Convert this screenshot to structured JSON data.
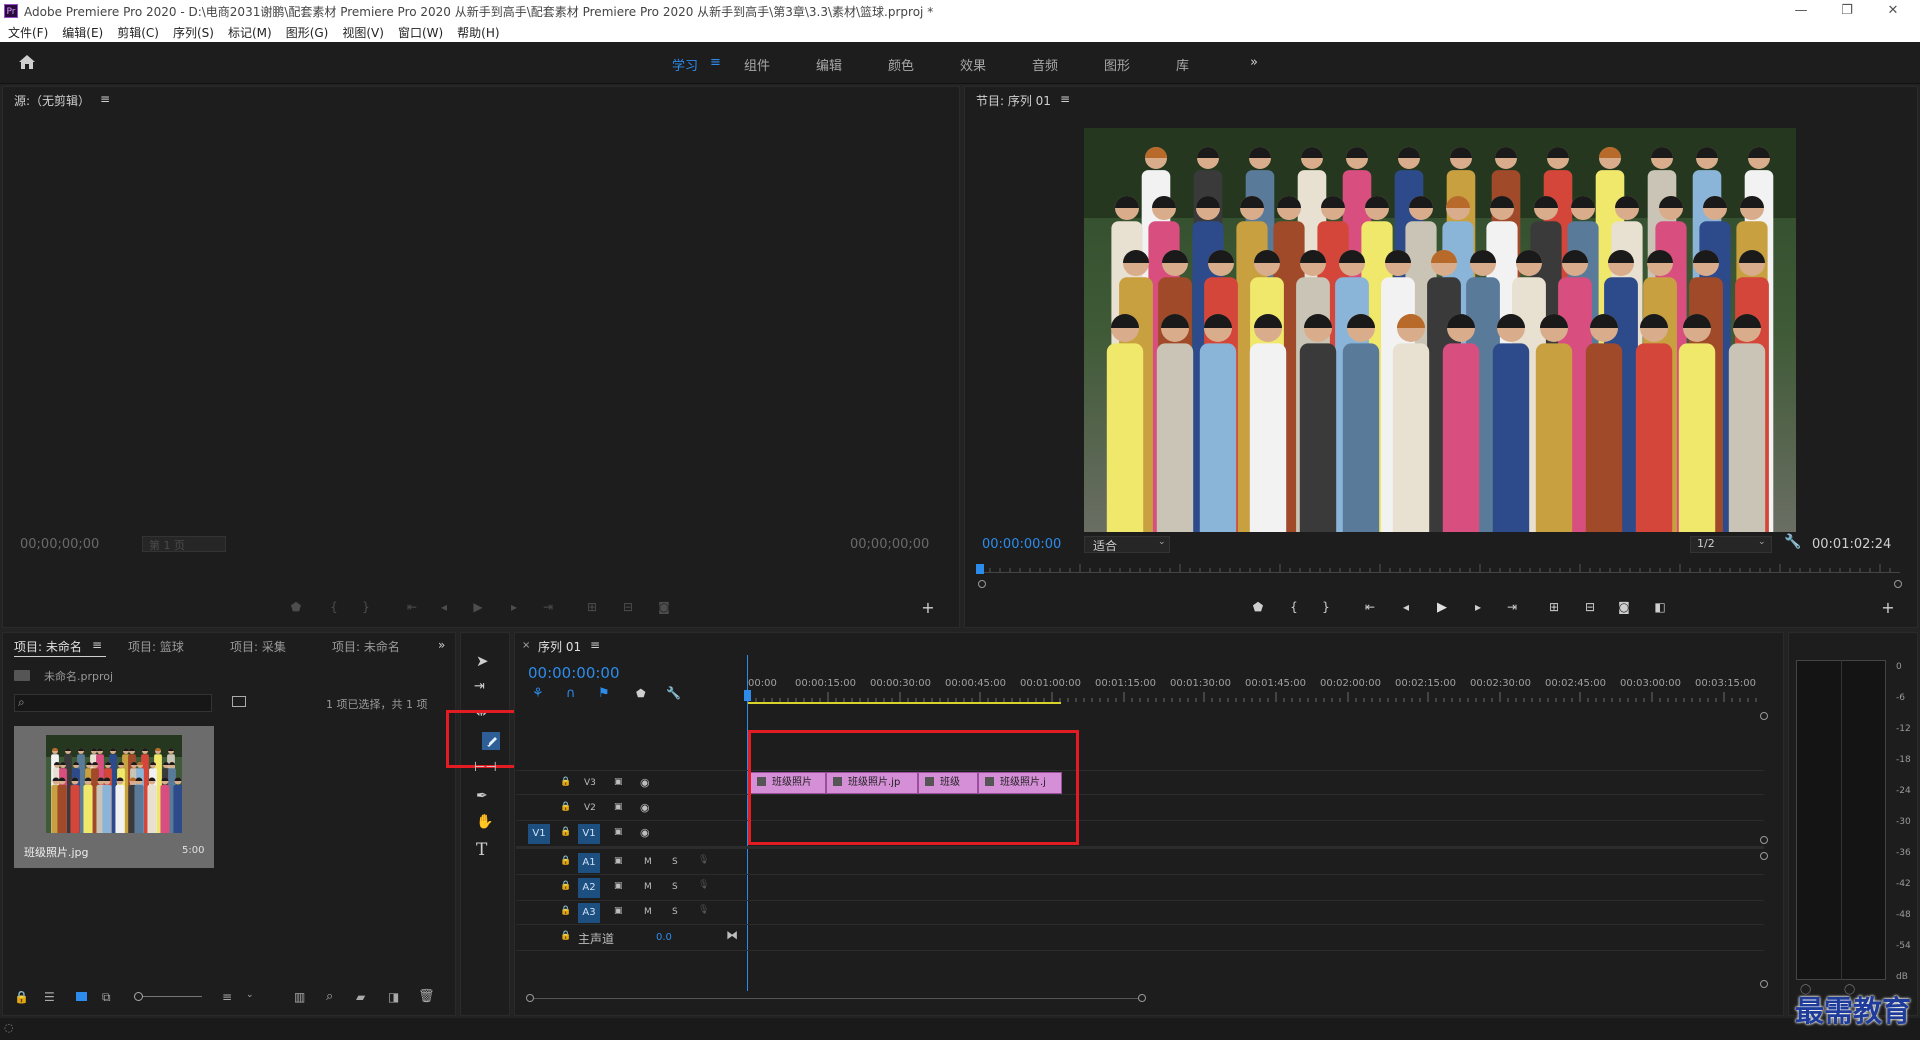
{
  "window": {
    "title": "Adobe Premiere Pro 2020 - D:\\电商2031谢鹏\\配套素材 Premiere Pro 2020 从新手到高手\\配套素材 Premiere Pro 2020 从新手到高手\\第3章\\3.3\\素材\\篮球.prproj *",
    "app_icon": "Pr",
    "controls": [
      "—",
      "❐",
      "✕"
    ]
  },
  "menu": [
    "文件(F)",
    "编辑(E)",
    "剪辑(C)",
    "序列(S)",
    "标记(M)",
    "图形(G)",
    "视图(V)",
    "窗口(W)",
    "帮助(H)"
  ],
  "workspaces": {
    "items": [
      "学习",
      "组件",
      "编辑",
      "颜色",
      "效果",
      "音频",
      "图形",
      "库"
    ],
    "active": "学习",
    "more": "»"
  },
  "source_monitor": {
    "title": "源:（无剪辑）",
    "timecode_left": "00;00;00;00",
    "page_select": "第 1 页",
    "timecode_right": "00;00;00;00"
  },
  "program_monitor": {
    "title": "节目: 序列 01",
    "timecode": "00:00:00:00",
    "fit": "适合",
    "resolution": "1/2",
    "duration": "00:01:02:24",
    "image_desc": "class-photo"
  },
  "project_panel": {
    "tabs": [
      "项目: 未命名",
      "项目: 篮球",
      "项目: 采集",
      "项目: 未命名"
    ],
    "more": "»",
    "file": "未命名.prproj",
    "selection_info": "1 项已选择，共 1 项",
    "item": {
      "name": "班级照片.jpg",
      "duration": "5:00"
    }
  },
  "tools": {
    "highlighted": "razor-tool",
    "type_tool_label": "T"
  },
  "timeline": {
    "tab": "序列 01",
    "timecode": "00:00:00:00",
    "ruler": [
      "00:00",
      "00:00:15:00",
      "00:00:30:00",
      "00:00:45:00",
      "00:01:00:00",
      "00:01:15:00",
      "00:01:30:00",
      "00:01:45:00",
      "00:02:00:00",
      "00:02:15:00",
      "00:02:30:00",
      "00:02:45:00",
      "00:03:00:00",
      "00:03:15:00"
    ],
    "video_tracks": [
      "V3",
      "V2",
      "V1"
    ],
    "source_patch_video": "V1",
    "audio_tracks": [
      "A1",
      "A2",
      "A3"
    ],
    "mute_label": "M",
    "solo_label": "S",
    "master": {
      "label": "主声道",
      "value": "0.0"
    },
    "clips": [
      "班级照片",
      "班级照片.jp",
      "班级",
      "班级照片.j"
    ]
  },
  "audio_meter": {
    "scale": [
      "0",
      "-6",
      "-12",
      "-18",
      "-24",
      "-30",
      "-36",
      "-42",
      "-48",
      "-54",
      "dB"
    ]
  },
  "watermark": "最需教育",
  "colors": {
    "accent": "#2d8ceb",
    "clip": "#d48fd6",
    "highlight_box": "#e31b23",
    "playhead": "#2d8ceb",
    "work_area": "#d8d22a"
  }
}
